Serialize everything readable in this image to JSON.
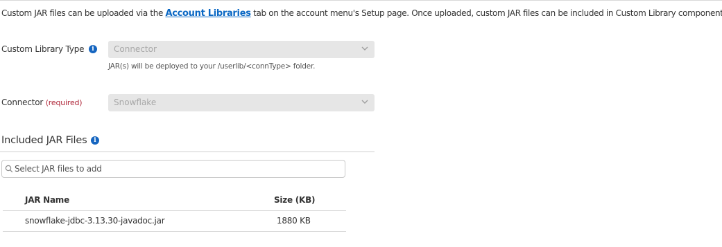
{
  "intro": {
    "before": "Custom JAR files can be uploaded via the ",
    "link": "Account Libraries",
    "after": " tab on the account menu's Setup page. Once uploaded, custom JAR files can be included in Custom Library components."
  },
  "library_type": {
    "label": "Custom Library Type",
    "value": "Connector",
    "help": "JAR(s) will be deployed to your /userlib/<connType> folder."
  },
  "connector": {
    "label": "Connector",
    "required": "(required)",
    "value": "Snowflake"
  },
  "included": {
    "title": "Included JAR Files",
    "search_placeholder": "Select JAR files to add"
  },
  "table": {
    "headers": {
      "name": "JAR Name",
      "size": "Size (KB)"
    },
    "rows": [
      {
        "name": "snowflake-jdbc-3.13.30-javadoc.jar",
        "size": "1880 KB"
      }
    ]
  },
  "colors": {
    "link": "#0a68c4",
    "info": "#1565c0",
    "required": "#b0283a",
    "disabled_bg": "#e6e6e6"
  },
  "icons": {
    "info": "info-icon",
    "chevron": "chevron-down-icon",
    "search": "search-icon"
  }
}
